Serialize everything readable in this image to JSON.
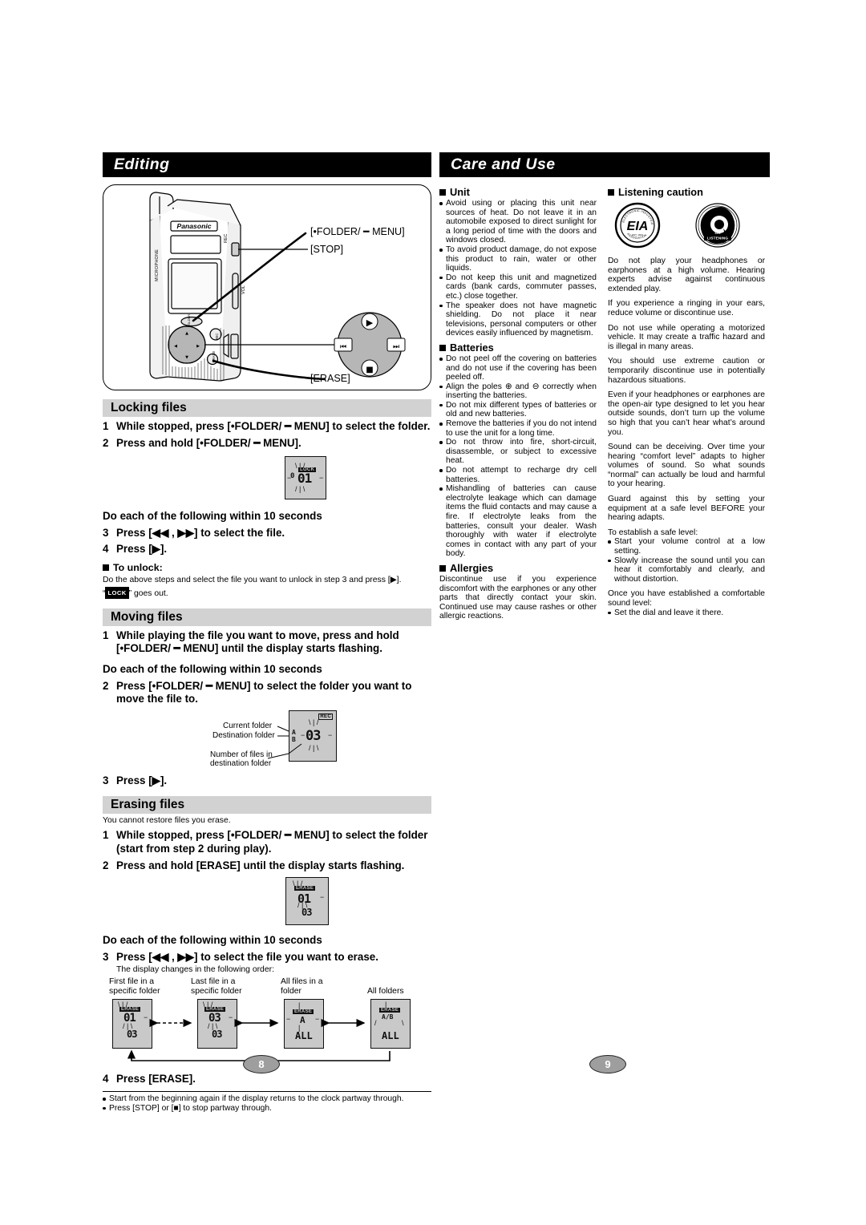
{
  "left": {
    "banner_title": "Editing",
    "illustration": {
      "brand": "Panasonic",
      "side_labels": [
        "MICROPHONE",
        "REC",
        "VOL"
      ],
      "callouts": [
        {
          "name": "folder-menu",
          "text": "[•FOLDER/ ━ MENU]"
        },
        {
          "name": "stop",
          "text": "[STOP]"
        },
        {
          "name": "erase",
          "text": "[ERASE]"
        }
      ],
      "jog_buttons": [
        "play",
        "rew",
        "ff",
        "stop"
      ]
    },
    "locking": {
      "heading": "Locking files",
      "steps": [
        {
          "num": "1",
          "text": "While stopped, press [•FOLDER/ ━ MENU] to select the folder."
        },
        {
          "num": "2",
          "text": "Press and hold [•FOLDER/ ━ MENU]."
        }
      ],
      "lcd": {
        "folder": "0",
        "file": "01",
        "lock_icon": "LOCK"
      },
      "within": "Do each of the following within 10 seconds",
      "steps2": [
        {
          "num": "3",
          "text": "Press [◀◀ , ▶▶] to select the file."
        },
        {
          "num": "4",
          "text": "Press [▶]."
        }
      ],
      "unlock_head": "To unlock:",
      "unlock_text": "Do the above steps and select the file you want to unlock in step 3 and press [▶].",
      "unlock_text2_pre": "“",
      "unlock_chip": "LOCK",
      "unlock_text2_post": "” goes out."
    },
    "moving": {
      "heading": "Moving files",
      "steps": [
        {
          "num": "1",
          "text": "While playing the file you want to move, press and hold [•FOLDER/ ━ MENU] until the display starts flashing."
        }
      ],
      "within": "Do each of the following within 10 seconds",
      "steps2": [
        {
          "num": "2",
          "text": "Press [•FOLDER/ ━ MENU] to select the folder you want to move the file to."
        }
      ],
      "lcd_labels": {
        "current_folder": "Current folder",
        "destination_folder": "Destination folder",
        "file_count": "Number of files in destination folder"
      },
      "lcd": {
        "rec_tag": "REC",
        "folder_a": "A",
        "folder_b": "B",
        "count": "03"
      },
      "steps3": [
        {
          "num": "3",
          "text": "Press [▶]."
        }
      ]
    },
    "erasing": {
      "heading": "Erasing files",
      "note": "You cannot restore files you erase.",
      "steps": [
        {
          "num": "1",
          "text": "While stopped, press [•FOLDER/ ━ MENU] to select the folder (start from step 2 during play)."
        },
        {
          "num": "2",
          "text": "Press and hold [ERASE] until the display starts flashing."
        }
      ],
      "lcd": {
        "erase_tag": "ERASE",
        "file": "01",
        "count": "03"
      },
      "within": "Do each of the following within 10 seconds",
      "steps2": [
        {
          "num": "3",
          "text": "Press [◀◀ , ▶▶] to select the file you want to erase."
        }
      ],
      "flow_intro": "The display changes in the following order:",
      "flow": [
        {
          "caption": "First file in a specific folder",
          "erase_tag": "ERASE",
          "main": "01",
          "sub": "03"
        },
        {
          "caption": "Last file in a specific folder",
          "erase_tag": "ERASE",
          "main": "03",
          "sub": "03"
        },
        {
          "caption": "All files in a folder",
          "erase_tag": "ERASE",
          "main": "A",
          "sub": "ALL"
        },
        {
          "caption": "All folders",
          "erase_tag": "ERASE",
          "main": "A/B",
          "sub": "ALL"
        }
      ],
      "steps3": [
        {
          "num": "4",
          "text": "Press [ERASE]."
        }
      ],
      "footnotes": [
        "Start from the beginning again if the display returns to the clock partway through.",
        "Press [STOP] or [■] to stop partway through."
      ]
    }
  },
  "right": {
    "banner_title": "Care and Use",
    "unit": {
      "heading": "Unit",
      "bullets": [
        "Avoid using or placing this unit near sources of heat. Do not leave it in an automobile exposed to direct sunlight for a long period of time with the doors and windows closed.",
        "To avoid product damage, do not expose this product to rain, water or other liquids.",
        "Do not keep this unit and magnetized cards (bank cards, commuter passes, etc.) close together.",
        "The speaker does not have magnetic shielding. Do not place it near televisions, personal computers or other devices easily influenced by magnetism."
      ]
    },
    "batteries": {
      "heading": "Batteries",
      "bullets": [
        "Do not peel off the covering on batteries and do not use if the covering has been peeled off.",
        "Align the poles ⊕ and ⊖ correctly when inserting the batteries.",
        "Do not mix different types of batteries or old and new batteries.",
        "Remove the batteries if you do not intend to use the unit for a long time.",
        "Do not throw into fire, short-circuit, disassemble, or subject to excessive heat.",
        "Do not attempt to recharge dry cell batteries.",
        "Mishandling of batteries can cause electrolyte leakage which can damage items the fluid contacts and may cause a fire. If electrolyte leaks from the batteries, consult your dealer. Wash thoroughly with water if electrolyte comes in contact with any part of your body."
      ]
    },
    "allergies": {
      "heading": "Allergies",
      "text": "Discontinue use if you experience discomfort with the earphones or any other parts that directly contact your skin. Continued use may cause rashes or other allergic reactions."
    },
    "listening": {
      "heading": "Listening caution",
      "logo_eia": {
        "center": "EIA",
        "ring_top": "ELECTRONIC INDUSTRIES",
        "ring_bottom": "ASSOCIATION",
        "est": "EST. 1924"
      },
      "logo_safe": {
        "badge": "LISTENING",
        "sub_top": "SAFE",
        "sub_bottom": "IT'S A GOOD IDEA"
      },
      "paragraphs": [
        "Do not play your headphones or earphones at a high volume. Hearing experts advise against continuous extended play.",
        "If you experience a ringing in your ears, reduce volume or discontinue use.",
        "Do not use while operating a motorized vehicle. It may create a traffic hazard and is illegal in many areas.",
        "You should use extreme caution or temporarily discontinue use in potentially hazardous situations.",
        "Even if your headphones or earphones are the open-air type designed to let you hear outside sounds, don’t turn up the volume so high that you can’t hear what’s around you.",
        "Sound can be deceiving. Over time your hearing “comfort level” adapts to higher volumes of sound. So what sounds “normal” can actually be loud and harmful to your hearing.",
        "Guard against this by setting your equipment at a safe level BEFORE your hearing adapts."
      ],
      "establish_label": "To establish a safe level:",
      "establish_bullets": [
        "Start your volume control at a low setting.",
        "Slowly increase the sound until you can hear it comfortably and clearly, and without distortion."
      ],
      "once_label": "Once you have established a comfortable sound level:",
      "once_bullets": [
        "Set the dial and leave it there."
      ]
    }
  },
  "footer": {
    "page_left": "8",
    "page_right": "9"
  }
}
